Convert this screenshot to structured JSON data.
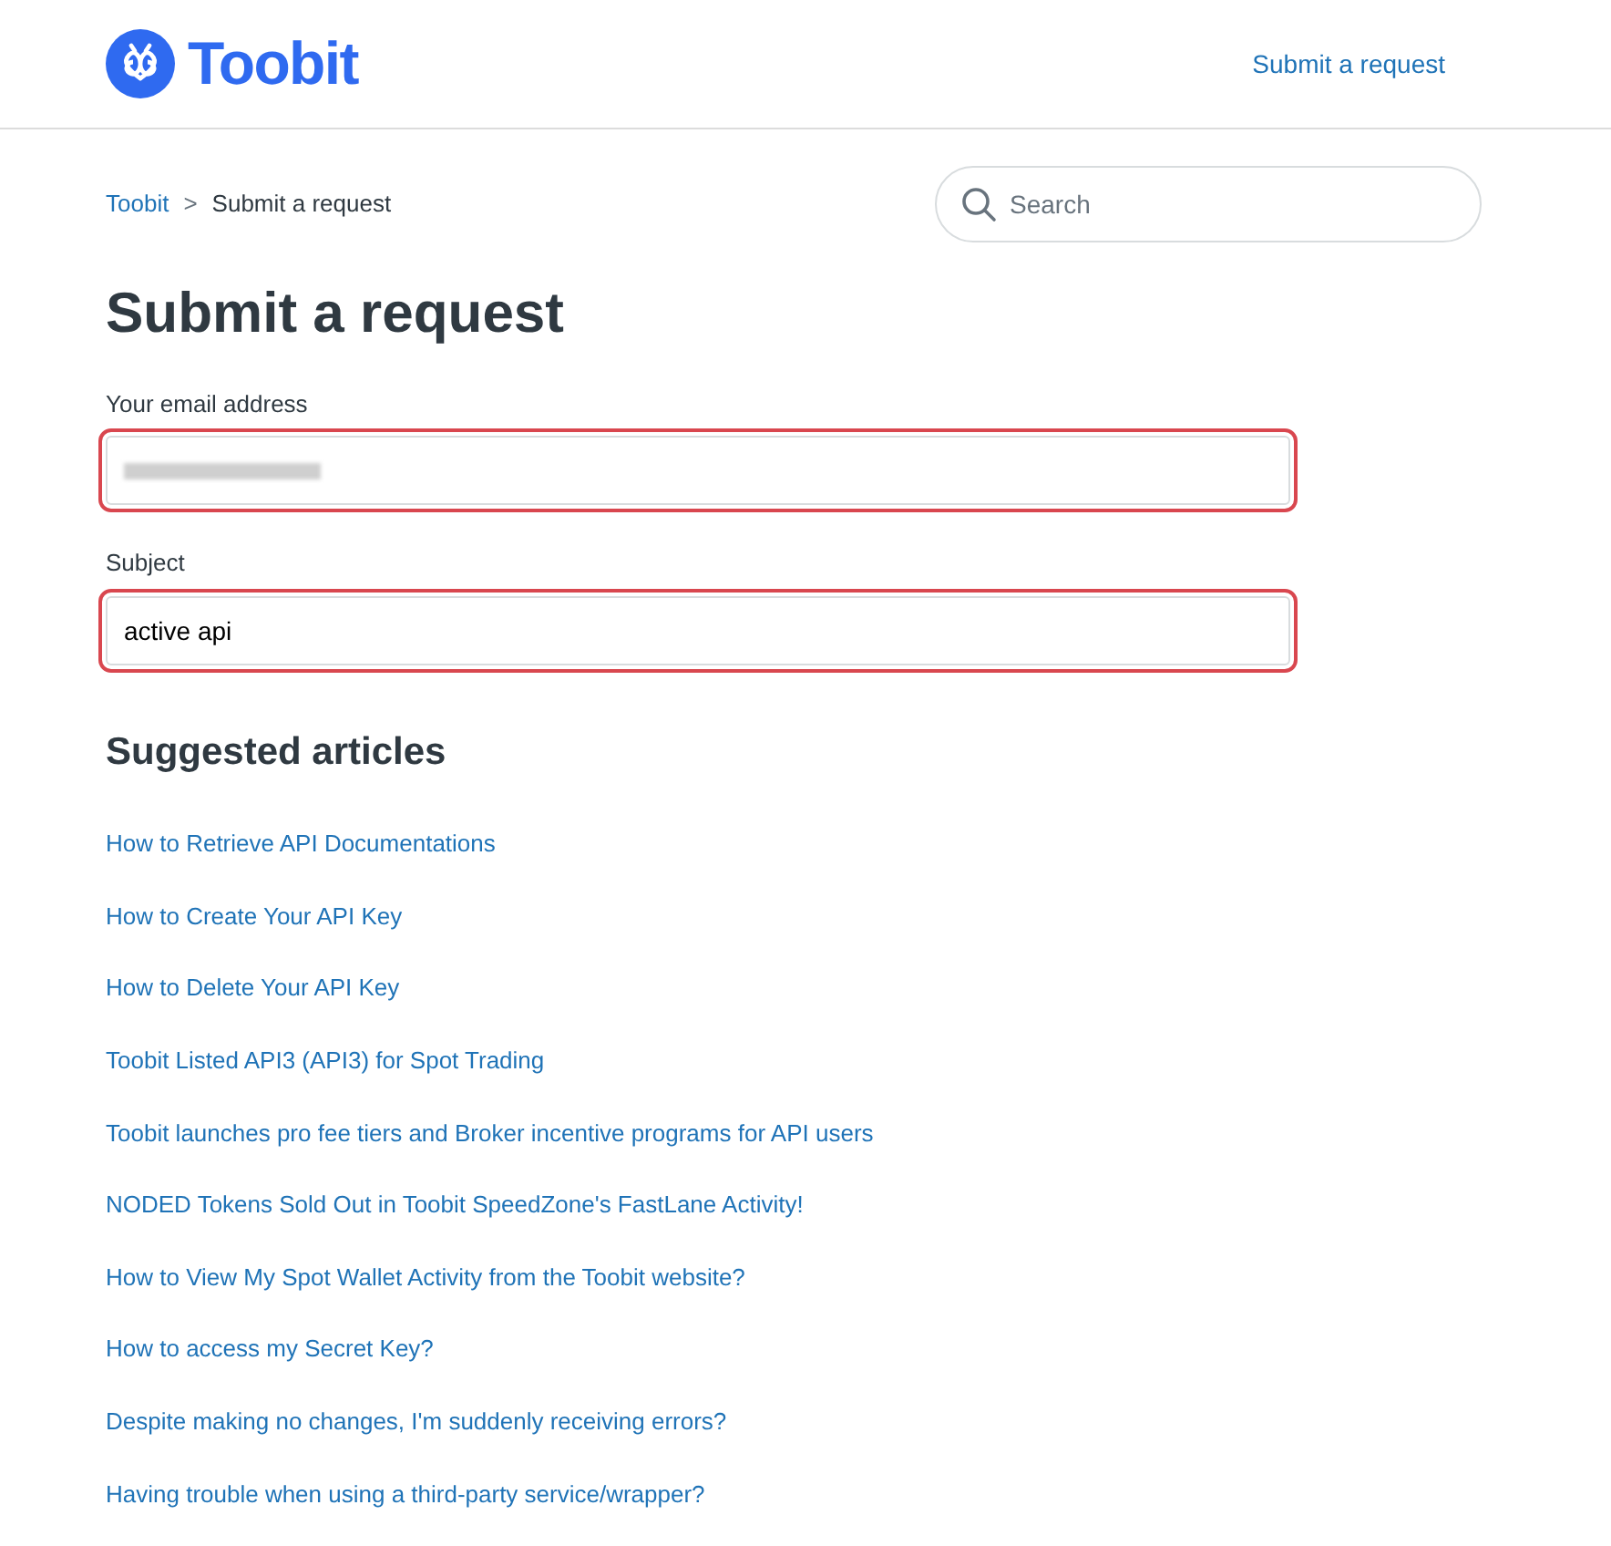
{
  "header": {
    "logo_text": "Toobit",
    "nav_link": "Submit a request"
  },
  "breadcrumbs": [
    {
      "label": "Toobit",
      "link": true
    },
    {
      "label": ">",
      "kind": "separator"
    },
    {
      "label": "Submit a request",
      "link": false
    }
  ],
  "search": {
    "placeholder": "Search"
  },
  "title": "Submit a request",
  "fields": [
    {
      "label": "Your email address",
      "redacted": true,
      "highlighted": true
    },
    {
      "label": "Subject",
      "value": "active api",
      "redacted": false,
      "highlighted": true
    }
  ],
  "suggested": {
    "heading": "Suggested articles",
    "articles": [
      "How to Retrieve API Documentations",
      "How to Create Your API Key",
      "How to Delete Your API Key",
      "Toobit Listed API3 (API3) for Spot Trading",
      "Toobit launches pro fee tiers and Broker incentive programs for API users",
      "NODED Tokens Sold Out in Toobit SpeedZone's FastLane Activity!",
      "How to View My Spot Wallet Activity from the Toobit website?",
      "How to access my Secret Key?",
      "Despite making no changes, I'm suddenly receiving errors?",
      "Having trouble when using a third-party service/wrapper?"
    ]
  }
}
